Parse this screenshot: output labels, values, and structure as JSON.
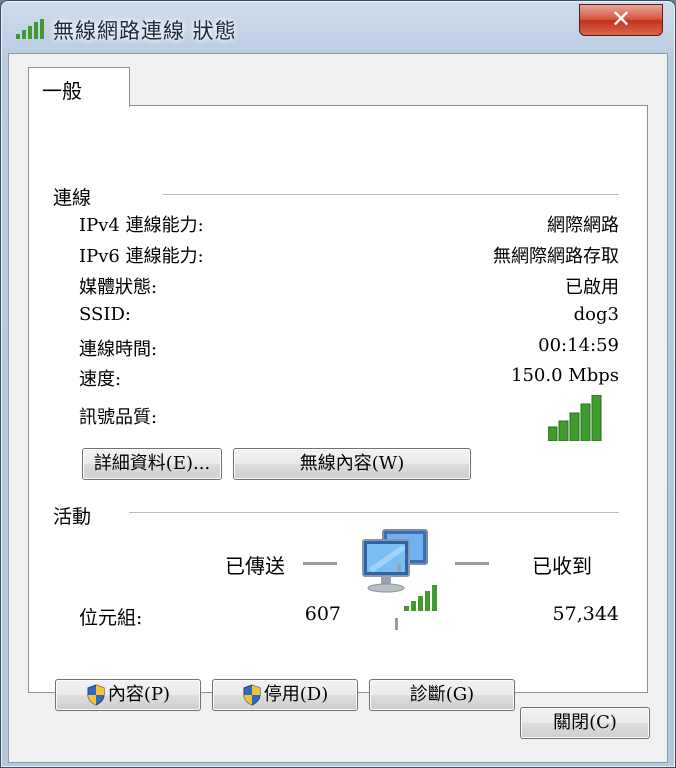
{
  "window": {
    "title": "無線網路連線 狀態",
    "close_glyph": "✕"
  },
  "tabs": [
    {
      "label": "一般"
    }
  ],
  "connection": {
    "group_title": "連線",
    "rows": [
      {
        "label": "IPv4 連線能力:",
        "value": "網際網路"
      },
      {
        "label": "IPv6 連線能力:",
        "value": "無網際網路存取"
      },
      {
        "label": "媒體狀態:",
        "value": "已啟用"
      },
      {
        "label": "SSID:",
        "value": "dog3"
      },
      {
        "label": "連線時間:",
        "value": "00:14:59"
      },
      {
        "label": "速度:",
        "value": "150.0 Mbps"
      }
    ],
    "signal_label": "訊號品質:",
    "signal_bars": 5,
    "signal_bars_max": 5,
    "details_button": "詳細資料(E)...",
    "wireless_props_button": "無線內容(W)"
  },
  "activity": {
    "group_title": "活動",
    "sent_label": "已傳送",
    "received_label": "已收到",
    "bytes_label": "位元組:",
    "bytes_sent": "607",
    "bytes_received": "57,344"
  },
  "actions": {
    "properties_button": "內容(P)",
    "disable_button": "停用(D)",
    "diagnose_button": "診斷(G)"
  },
  "footer": {
    "close_button": "關閉(C)"
  },
  "colors": {
    "signal_green": "#3f9b2e",
    "title_bar": "#b9cbe1",
    "close_red": "#c0321c"
  },
  "icons": [
    "wifi-signal-icon",
    "close-icon",
    "shield-icon",
    "network-computers-icon"
  ]
}
